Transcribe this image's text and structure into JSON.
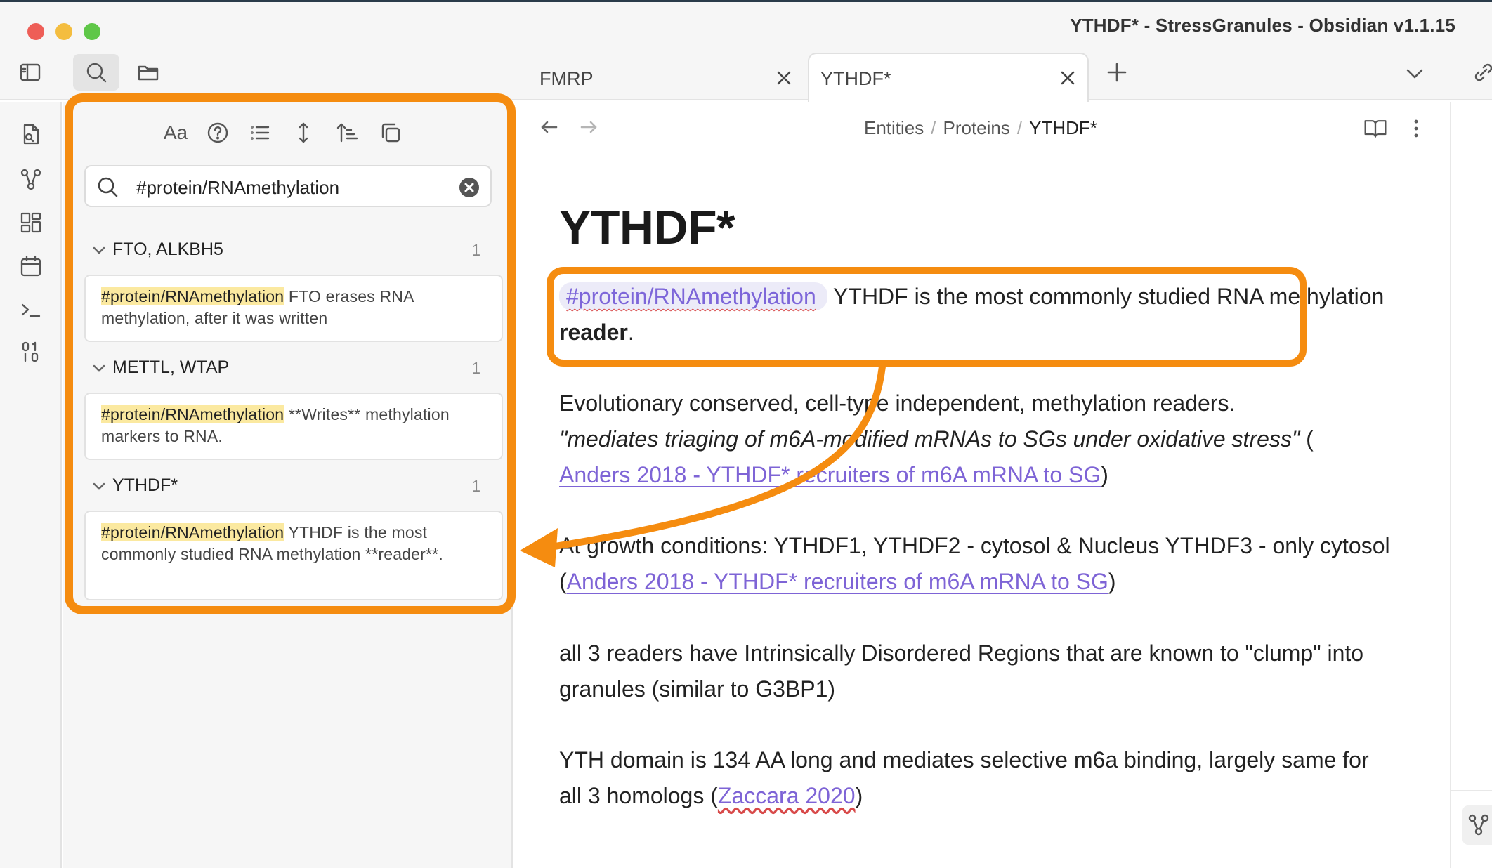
{
  "window": {
    "title": "YTHDF* - StressGranules - Obsidian v1.1.15"
  },
  "tabs": [
    {
      "label": "FMRP",
      "active": false
    },
    {
      "label": "YTHDF*",
      "active": true
    }
  ],
  "search": {
    "query": "#protein/RNAmethylation",
    "case_label": "Aa",
    "groups": [
      {
        "title": "FTO, ALKBH5",
        "count": "1",
        "tag": "#protein/RNAmethylation",
        "snippet": " FTO erases RNA methylation, after it was written"
      },
      {
        "title": "METTL, WTAP",
        "count": "1",
        "tag": "#protein/RNAmethylation",
        "snippet": " **Writes** methylation markers to RNA."
      },
      {
        "title": "YTHDF*",
        "count": "1",
        "tag": "#protein/RNAmethylation",
        "snippet": " YTHDF is the most commonly studied RNA methylation **reader**."
      }
    ]
  },
  "breadcrumb": {
    "items": [
      "Entities",
      "Proteins",
      "YTHDF*"
    ],
    "separator": "/"
  },
  "note": {
    "title": "YTHDF*",
    "p1_tag": "#protein/RNAmethylation",
    "p1_text": " YTHDF is the most commonly studied RNA methylation ",
    "p1_bold": "reader",
    "p1_end": ".",
    "p2_line1": "Evolutionary conserved, cell-type independent, methylation readers.",
    "p2_quote": "\"mediates triaging of m6A-modified mRNAs to SGs under oxidative stress\"",
    "p2_open": " (",
    "p2_link": "Anders 2018 - YTHDF* recruiters of m6A mRNA to SG",
    "p2_close": ")",
    "p3_text": "At growth conditions:  YTHDF1, YTHDF2 - cytosol & Nucleus YTHDF3 - only cytosol (",
    "p3_link": "Anders 2018 - YTHDF* recruiters of m6A mRNA to SG",
    "p3_close": ")",
    "p4_text": "all 3 readers have Intrinsically Disordered Regions that are known to \"clump\" into granules (similar to G3BP1)",
    "p5_text": "YTH domain is 134 AA long and mediates selective m6a binding, largely same for all 3 homologs (",
    "p5_link": "Zaccara 2020",
    "p5_close": ")"
  },
  "colors": {
    "annotation": "#f58c10",
    "link": "#7e64d6",
    "highlight": "#fbe9a0"
  }
}
